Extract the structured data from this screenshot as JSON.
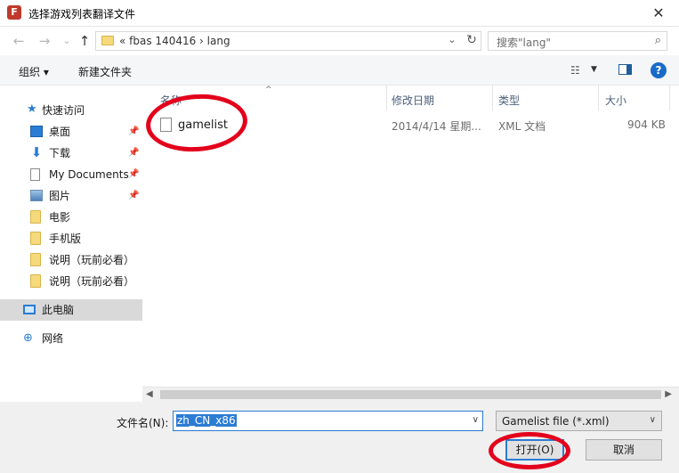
{
  "window": {
    "title": "选择游戏列表翻译文件",
    "app_icon": "F",
    "close": "✕"
  },
  "nav": {
    "back": "←",
    "forward": "→",
    "recent": "⌄",
    "up": "↑",
    "breadcrumb": "«  fbas 140416  ›  lang",
    "refresh": "↻",
    "dropdown": "⌄"
  },
  "search": {
    "placeholder": "搜索\"lang\"",
    "icon": "⌕"
  },
  "toolbar": {
    "organize": "组织 ▾",
    "new_folder": "新建文件夹",
    "view_icon": "☷",
    "view_dd": "▼",
    "help": "?"
  },
  "sidebar": {
    "items": [
      {
        "label": "快速访问",
        "icon": "star-icon",
        "glyph": "★",
        "pinned": false
      },
      {
        "label": "桌面",
        "icon": "desktop-icon",
        "pinned": true
      },
      {
        "label": "下载",
        "icon": "download-icon",
        "glyph": "⬇",
        "pinned": true
      },
      {
        "label": "My Documents",
        "icon": "document-icon",
        "pinned": true
      },
      {
        "label": "图片",
        "icon": "pictures-icon",
        "pinned": true
      },
      {
        "label": "电影",
        "icon": "folder-icon",
        "pinned": false
      },
      {
        "label": "手机版",
        "icon": "folder-icon",
        "pinned": false
      },
      {
        "label": "说明（玩前必看）",
        "icon": "folder-icon",
        "pinned": false
      },
      {
        "label": "说明（玩前必看）",
        "icon": "folder-icon",
        "pinned": false
      },
      {
        "label": "此电脑",
        "icon": "pc-icon",
        "pinned": false
      },
      {
        "label": "网络",
        "icon": "network-icon",
        "glyph": "⊕",
        "pinned": false
      }
    ],
    "pin_glyph": "📌"
  },
  "columns": {
    "name": "名称",
    "modified": "修改日期",
    "type": "类型",
    "size": "大小",
    "sort": "^"
  },
  "files": [
    {
      "name": "gamelist",
      "modified": "2014/4/14 星期...",
      "type": "XML 文档",
      "size": "904 KB"
    }
  ],
  "hscroll": {
    "left": "◀",
    "right": "▶"
  },
  "bottom": {
    "filename_label": "文件名(N):",
    "filename_value": "zh_CN_x86",
    "filename_dd": "∨",
    "filter": "Gamelist file (*.xml)",
    "filter_dd": "∨",
    "open": "打开(O)",
    "cancel": "取消"
  },
  "colors": {
    "accent": "#2b7cd3",
    "annotation_red": "#e3001b"
  }
}
